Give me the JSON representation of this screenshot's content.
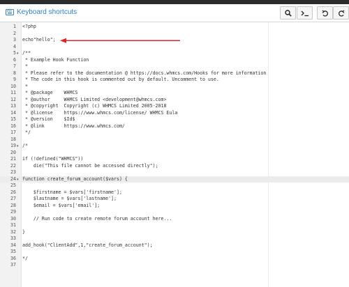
{
  "toolbar": {
    "shortcuts_label": "Keyboard shortcuts",
    "buttons": [
      "search-icon",
      "terminal-icon",
      "undo-icon",
      "redo-icon"
    ]
  },
  "annotation": {
    "color": "#e02424",
    "points_to_line": 3
  },
  "editor": {
    "active_line": 24,
    "fold_markers": [
      5,
      19,
      24
    ],
    "lines": [
      "<?php",
      "",
      "echo\"hello\";",
      "",
      "/**",
      " * Example Hook Function",
      " *",
      " * Please refer to the documentation @ https://docs.whmcs.com/Hooks for more information",
      " * The code in this hook is commented out by default. Uncomment to use.",
      " *",
      " * @package    WHMCS",
      " * @author     WHMCS Limited <development@whmcs.com>",
      " * @copyright  Copyright (c) WHMCS Limited 2005-2018",
      " * @license    https://www.whmcs.com/license/ WHMCS Eula",
      " * @version    $Id$",
      " * @link       https://www.whmcs.com/",
      " */",
      "",
      "/*",
      "",
      "if (!defined(\"WHMCS\"))",
      "    die(\"This file cannot be accessed directly\");",
      "",
      "function create_forum_account($vars) {",
      "",
      "    $firstname = $vars['firstname'];",
      "    $lastname = $vars['lastname'];",
      "    $email = $vars['email'];",
      "",
      "    // Run code to create remote forum account here...",
      "",
      "}",
      "",
      "add_hook(\"ClientAdd\",1,\"create_forum_account\");",
      "",
      "*/",
      ""
    ]
  }
}
